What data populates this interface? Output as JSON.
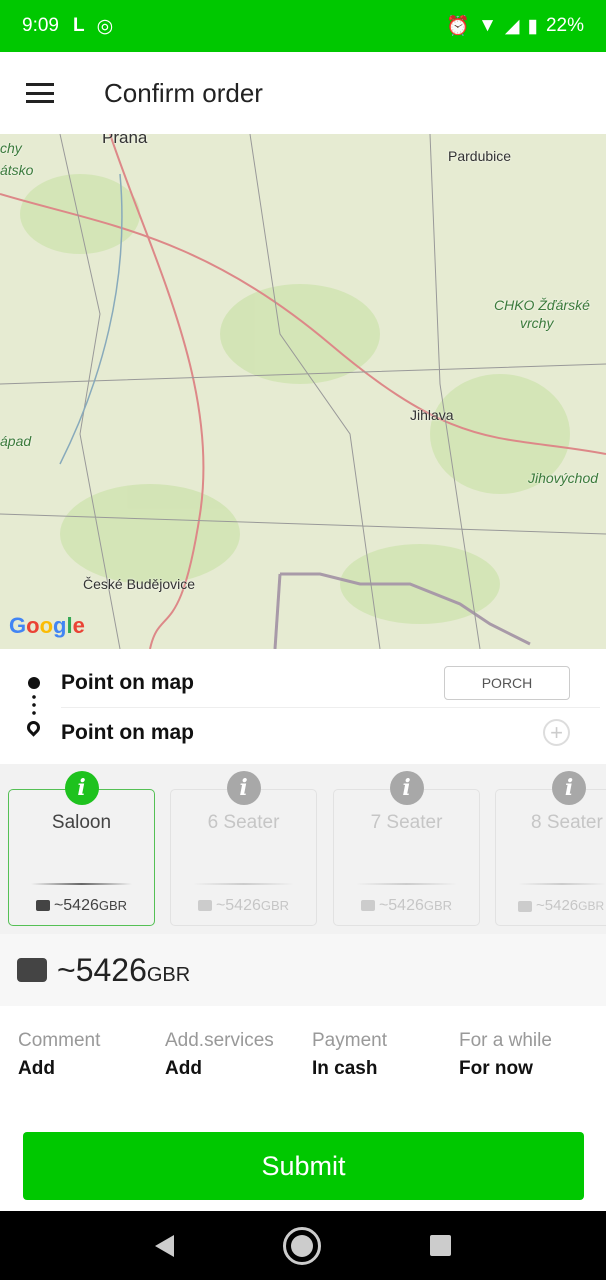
{
  "status_bar": {
    "time": "9:09",
    "battery": "22%",
    "icons": [
      "scooter-icon",
      "app-icon",
      "alarm-icon",
      "data-icon",
      "wifi-icon",
      "signal-icon",
      "battery-icon"
    ]
  },
  "header": {
    "title": "Confirm order",
    "menu_icon": "hamburger-icon"
  },
  "map": {
    "labels": [
      "Praha",
      "Pardubice",
      "CHKO Žďárské",
      "vrchy",
      "Jihlava",
      "Jihovýchod",
      "České Budějovice",
      "chy",
      "átsko",
      "ápad"
    ],
    "attribution": "Google"
  },
  "route": {
    "from": "Point on map",
    "to": "Point on map",
    "porch_label": "PORCH"
  },
  "cars": [
    {
      "name": "Saloon",
      "price": "~5426",
      "currency": "GBR",
      "selected": true
    },
    {
      "name": "6 Seater",
      "price": "~5426",
      "currency": "GBR",
      "selected": false
    },
    {
      "name": "7 Seater",
      "price": "~5426",
      "currency": "GBR",
      "selected": false
    },
    {
      "name": "8 Seater",
      "price": "~5426",
      "currency": "GBR",
      "selected": false
    }
  ],
  "total": {
    "price": "~5426",
    "currency": "GBR"
  },
  "options": [
    {
      "label": "Comment",
      "value": "Add"
    },
    {
      "label": "Add.services",
      "value": "Add"
    },
    {
      "label": "Payment",
      "value": "In cash"
    },
    {
      "label": "For a while",
      "value": "For now"
    }
  ],
  "submit_label": "Submit",
  "colors": {
    "accent": "#00c800",
    "selected_info": "#1ec21e"
  }
}
